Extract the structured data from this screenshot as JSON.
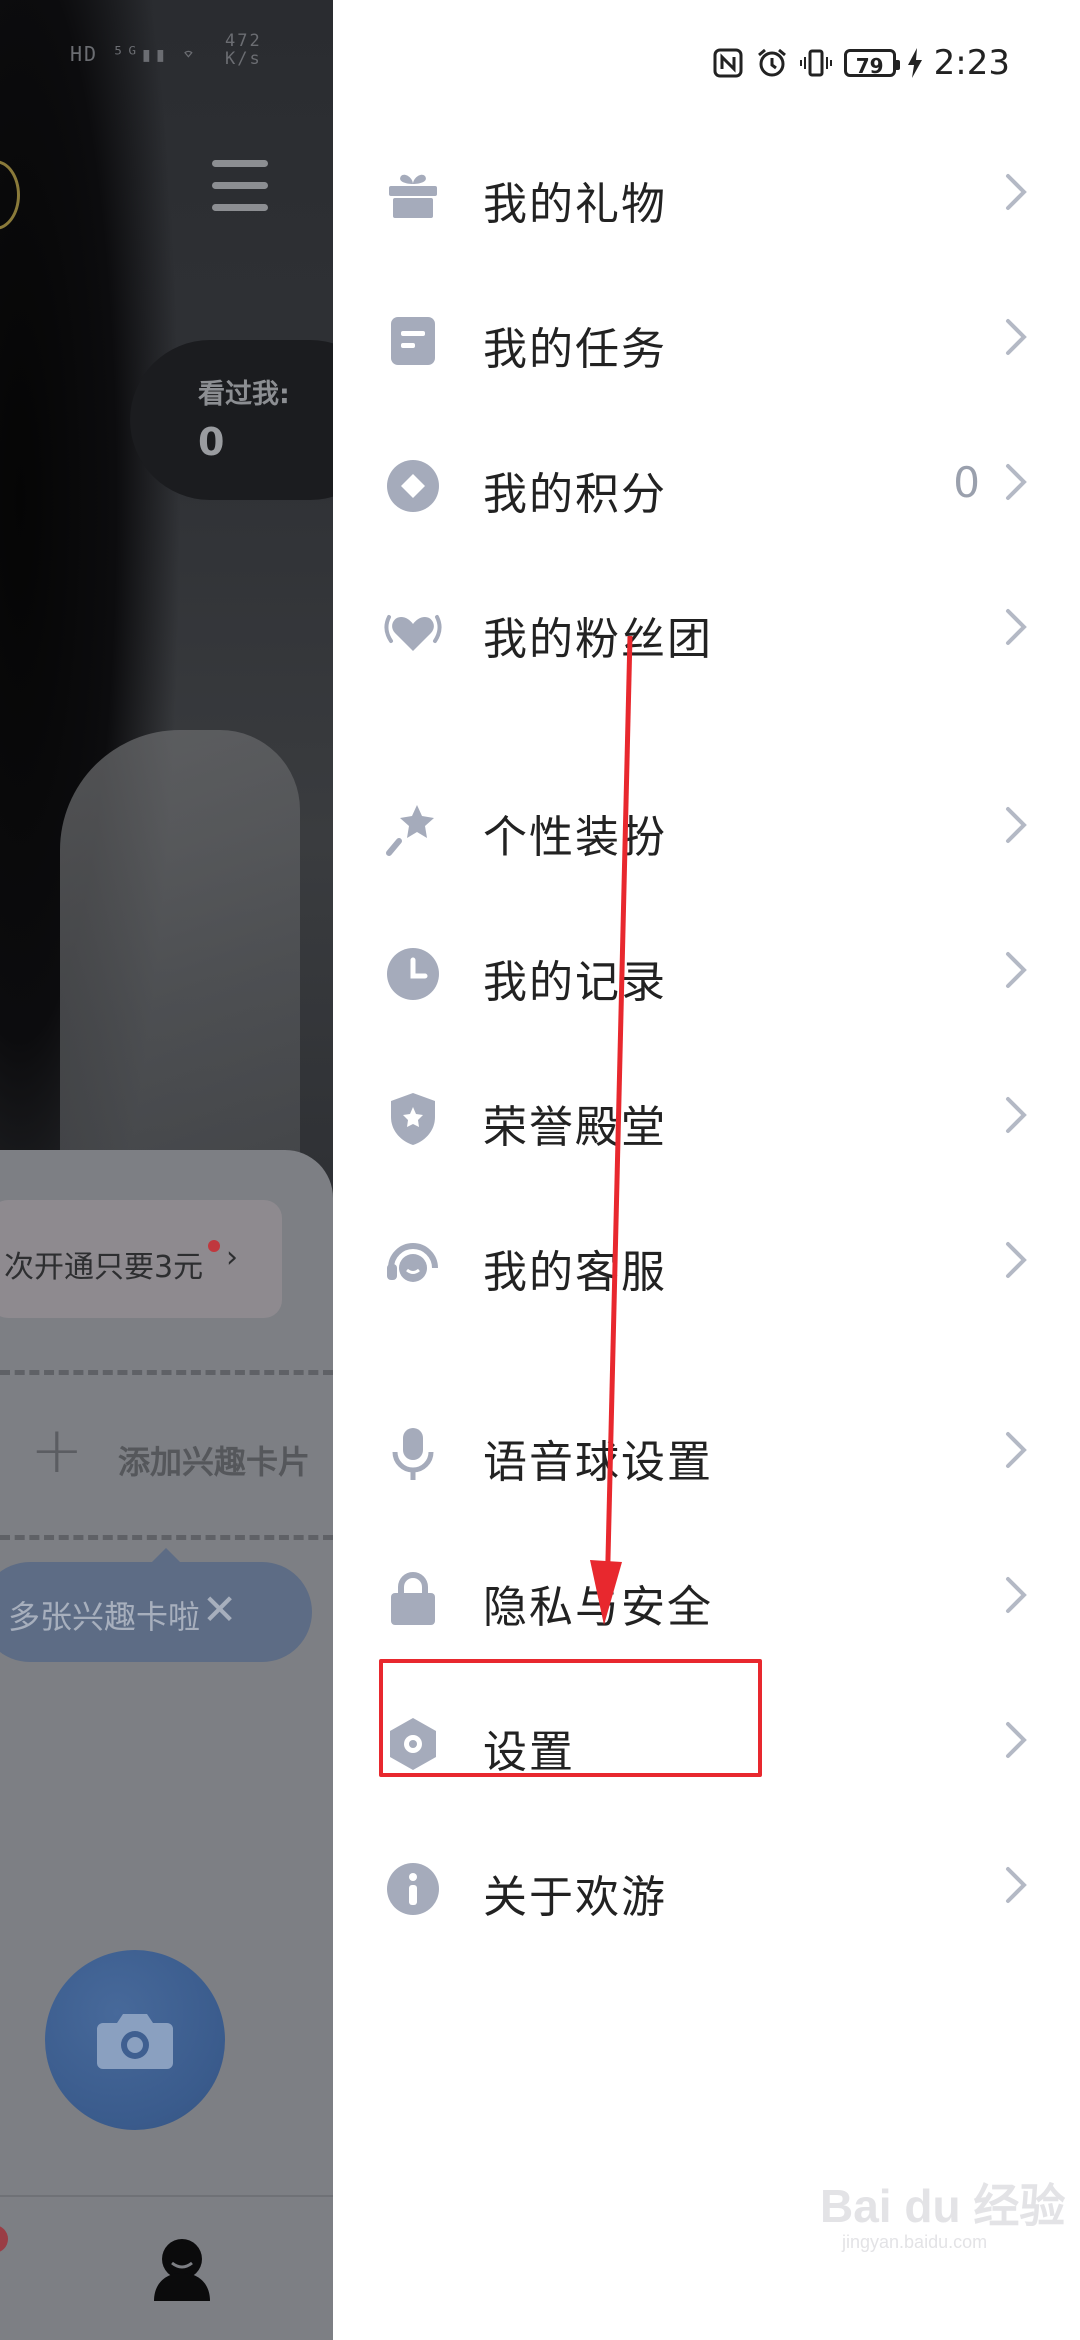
{
  "status_bar": {
    "battery": "79",
    "time": "2:23",
    "bg_speed_value": "472",
    "bg_speed_unit": "K/s"
  },
  "background_app": {
    "viewed_label": "看过我:",
    "viewed_count": "0",
    "vip_promo": "次开通只要3元",
    "add_interest_card": "添加兴趣卡片",
    "tip_text": "多张兴趣卡啦"
  },
  "drawer": {
    "items": [
      {
        "label": "我的礼物",
        "icon": "gift-icon"
      },
      {
        "label": "我的任务",
        "icon": "task-icon"
      },
      {
        "label": "我的积分",
        "icon": "points-icon",
        "value": "0"
      },
      {
        "label": "我的粉丝团",
        "icon": "fan-club-icon"
      },
      {
        "label": "个性装扮",
        "icon": "dress-up-icon"
      },
      {
        "label": "我的记录",
        "icon": "clock-icon"
      },
      {
        "label": "荣誉殿堂",
        "icon": "honor-shield-icon"
      },
      {
        "label": "我的客服",
        "icon": "headset-icon"
      },
      {
        "label": "语音球设置",
        "icon": "microphone-icon"
      },
      {
        "label": "隐私与安全",
        "icon": "lock-icon"
      },
      {
        "label": "设置",
        "icon": "settings-hexagon-icon"
      },
      {
        "label": "关于欢游",
        "icon": "info-icon"
      }
    ]
  },
  "watermark": {
    "brand": "Bai du 经验",
    "url": "jingyan.baidu.com"
  },
  "colors": {
    "icon_gray": "#A5ABBB",
    "highlight_red": "#E8282E",
    "text": "#222222"
  }
}
